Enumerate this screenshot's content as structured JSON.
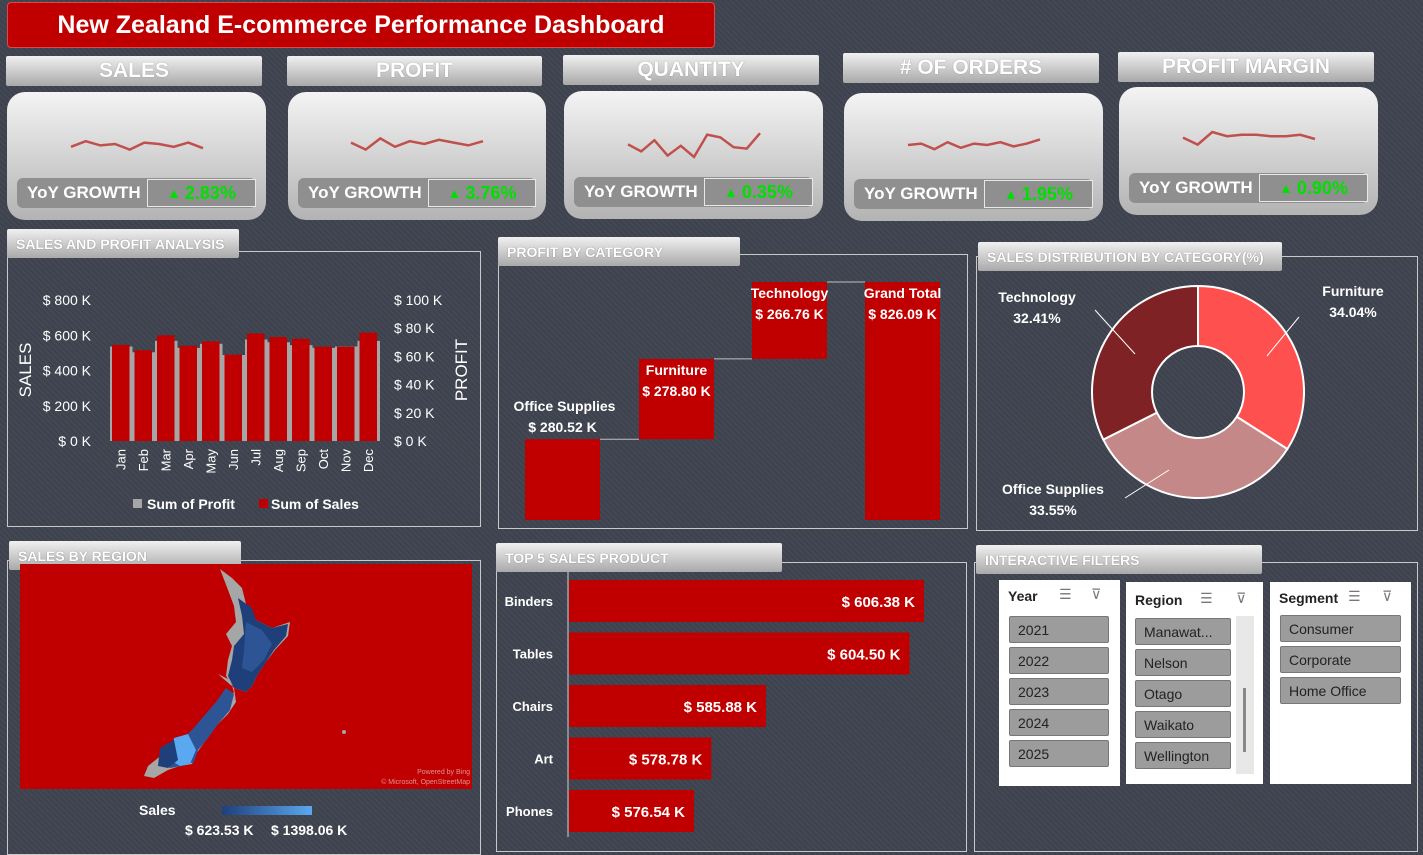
{
  "title": "New Zealand E-commerce Performance Dashboard",
  "kpis": [
    {
      "label": "SALES",
      "growth_label": "YoY GROWTH",
      "growth": "2.83%",
      "spark": [
        4.2,
        4.6,
        4.3,
        4.4,
        4.0,
        4.5,
        4.4,
        4.2,
        4.5,
        4.1
      ]
    },
    {
      "label": "PROFIT",
      "growth_label": "YoY GROWTH",
      "growth": "3.76%",
      "spark": [
        4.5,
        4.0,
        4.8,
        4.2,
        4.6,
        4.4,
        4.7,
        4.5,
        4.3,
        4.6
      ]
    },
    {
      "label": "QUANTITY",
      "growth_label": "YoY GROWTH",
      "growth": "0.35%",
      "spark": [
        4.3,
        3.8,
        4.6,
        3.5,
        4.2,
        3.4,
        5.0,
        4.8,
        4.1,
        4.0,
        5.1
      ]
    },
    {
      "label": "# OF ORDERS",
      "growth_label": "YoY GROWTH",
      "growth": "1.95%",
      "spark": [
        4.4,
        4.5,
        4.1,
        4.6,
        4.2,
        4.5,
        4.4,
        4.6,
        4.3,
        4.5,
        4.8
      ]
    },
    {
      "label": "PROFIT MARGIN",
      "growth_label": "YoY GROWTH",
      "growth": "0.90%",
      "spark": [
        4.5,
        4.0,
        4.9,
        4.6,
        4.7,
        4.7,
        4.6,
        4.6,
        4.7,
        4.4
      ]
    }
  ],
  "sections": {
    "sales_profit": "SALES AND PROFIT ANALYSIS",
    "profit_category": "PROFIT BY CATEGORY",
    "sales_distribution": "SALES DISTRIBUTION BY CATEGORY(%)",
    "sales_region": "SALES BY REGION",
    "top5": "TOP 5 SALES PRODUCT",
    "filters": "INTERACTIVE FILTERS"
  },
  "chart_data": [
    {
      "type": "bar",
      "title": "SALES AND PROFIT ANALYSIS",
      "categories": [
        "Jan",
        "Feb",
        "Mar",
        "Apr",
        "May",
        "Jun",
        "Jul",
        "Aug",
        "Sep",
        "Oct",
        "Nov",
        "Dec"
      ],
      "series": [
        {
          "name": "Sum of Profit",
          "axis": "right",
          "values": [
            67,
            63,
            71,
            66,
            69,
            61,
            72,
            70,
            68,
            66,
            67,
            71
          ]
        },
        {
          "name": "Sum of Sales",
          "axis": "left",
          "values": [
            545,
            515,
            600,
            540,
            565,
            490,
            610,
            590,
            580,
            535,
            535,
            615
          ]
        }
      ],
      "ylabel": "SALES",
      "y2label": "PROFIT",
      "ylim": [
        0,
        800
      ],
      "y2lim": [
        0,
        100
      ],
      "yticks": [
        "$ 800 K",
        "$ 600 K",
        "$ 400 K",
        "$ 200 K",
        "$ 0 K"
      ],
      "y2ticks": [
        "$ 100 K",
        "$ 80 K",
        "$ 60 K",
        "$ 40 K",
        "$ 20 K",
        "$ 0 K"
      ],
      "colors": {
        "Sum of Profit": "#a6a6a6",
        "Sum of Sales": "#c00000"
      },
      "legend": "bottom"
    },
    {
      "type": "bar",
      "subtype": "waterfall",
      "title": "PROFIT BY CATEGORY",
      "categories": [
        "Office Supplies",
        "Furniture",
        "Technology",
        "Grand Total"
      ],
      "values": [
        280.52,
        278.8,
        266.76,
        826.09
      ],
      "labels": [
        "$ 280.52 K",
        "$ 278.80 K",
        "$ 266.76 K",
        "$ 826.09 K"
      ],
      "color": "#c00000"
    },
    {
      "type": "pie",
      "subtype": "donut",
      "title": "SALES DISTRIBUTION BY CATEGORY(%)",
      "categories": [
        "Furniture",
        "Office Supplies",
        "Technology"
      ],
      "values": [
        34.04,
        33.55,
        32.41
      ],
      "labels": [
        "34.04%",
        "33.55%",
        "32.41%"
      ],
      "colors": [
        "#ff5050",
        "#c48888",
        "#7f2225"
      ]
    },
    {
      "type": "bar",
      "orientation": "horizontal",
      "title": "TOP 5 SALES PRODUCT",
      "categories": [
        "Binders",
        "Tables",
        "Chairs",
        "Art",
        "Phones"
      ],
      "values": [
        606.38,
        604.5,
        585.88,
        578.78,
        576.54
      ],
      "labels": [
        "$ 606.38 K",
        "$ 604.50 K",
        "$ 585.88 K",
        "$ 578.78 K",
        "$ 576.54 K"
      ],
      "color": "#c00000"
    }
  ],
  "map": {
    "legend_title": "Sales",
    "legend_min": "$ 623.53 K",
    "legend_max": "$ 1398.06 K",
    "credit_1": "Powered by Bing",
    "credit_2": "© Microsoft, OpenStreetMap",
    "colors": {
      "background": "#c00000",
      "low": "#1f3f7a",
      "high": "#5aa8f0",
      "no_data": "#a6a6a6"
    }
  },
  "filters": {
    "year": {
      "title": "Year",
      "items": [
        "2021",
        "2022",
        "2023",
        "2024",
        "2025"
      ]
    },
    "region": {
      "title": "Region",
      "items": [
        "Manawat...",
        "Nelson",
        "Otago",
        "Waikato",
        "Wellington"
      ]
    },
    "segment": {
      "title": "Segment",
      "items": [
        "Consumer",
        "Corporate",
        "Home Office"
      ]
    }
  },
  "icons": {
    "multi_select": "multi-select-icon",
    "clear_filter": "clear-filter-icon",
    "growth_up": "triangle-up-icon"
  }
}
